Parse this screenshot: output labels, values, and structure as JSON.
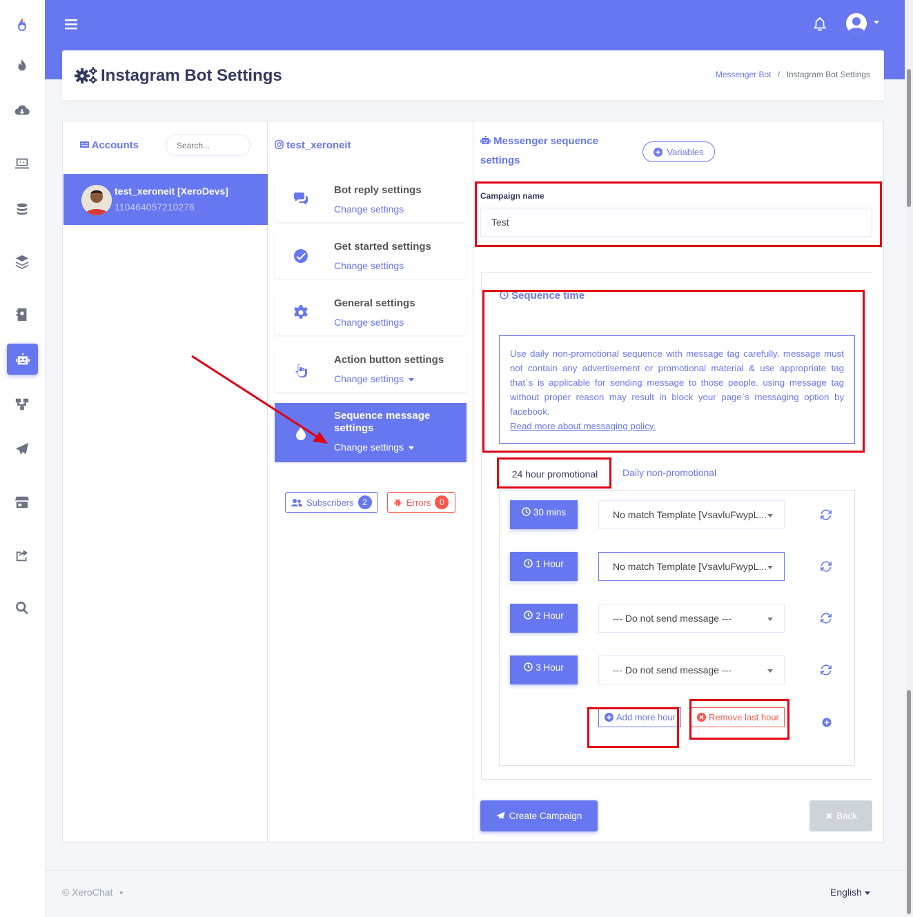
{
  "app": {
    "brand": "XeroChat",
    "accent": "#6777ef",
    "danger": "#fc544b"
  },
  "sidebar": {
    "icons": [
      "logo-icon",
      "fire-icon",
      "cloud-download-icon",
      "laptop-code-icon",
      "coins-icon",
      "layers-icon",
      "contact-book-icon",
      "robot-icon",
      "sitemap-icon",
      "paper-plane-icon",
      "store-icon",
      "share-icon",
      "search-icon"
    ]
  },
  "header": {
    "title": "Instagram Bot Settings",
    "breadcrumb": {
      "parent": "Messenger Bot",
      "separator": "/",
      "current": "Instagram Bot Settings"
    }
  },
  "accounts": {
    "title": "Accounts",
    "search_placeholder": "Search...",
    "items": [
      {
        "name": "test_xeroneit [XeroDevs]",
        "id": "110464057210276"
      }
    ]
  },
  "settings_column": {
    "title": "test_xeroneit",
    "items": [
      {
        "name": "Bot reply settings",
        "link": "Change settings",
        "icon": "comments-icon"
      },
      {
        "name": "Get started settings",
        "link": "Change settings",
        "icon": "check-circle-icon"
      },
      {
        "name": "General settings",
        "link": "Change settings",
        "icon": "gear-icon"
      },
      {
        "name": "Action button settings",
        "link": "Change settings",
        "icon": "hand-pointer-icon"
      },
      {
        "name": "Sequence message settings",
        "link": "Change settings",
        "icon": "tint-icon"
      }
    ],
    "subscribers": {
      "label": "Subscribers",
      "count": "2"
    },
    "errors": {
      "label": "Errors",
      "count": "0"
    }
  },
  "sequence": {
    "title": "Messenger sequence settings",
    "variables_label": "Variables",
    "campaign_label": "Campaign name",
    "campaign_value": "Test",
    "time_title": "Sequence time",
    "info_text": "Use daily non-promotional sequence with message tag carefully. message must not contain any advertisement or promotional material & use appropriate tag that`s is applicable for sending message to those people. using message tag without proper reason may result in block your page`s messaging option by facebook.",
    "info_link": "Read more about messaging policy.",
    "tabs": [
      "24 hour promotional",
      "Daily non-promotional"
    ],
    "rows": [
      {
        "time": "30 mins",
        "template": "No match Template [VsavluFwypL..."
      },
      {
        "time": "1 Hour",
        "template": "No match Template [VsavluFwypL..."
      },
      {
        "time": "2 Hour",
        "template": "--- Do not send message ---"
      },
      {
        "time": "3 Hour",
        "template": "--- Do not send message ---"
      }
    ],
    "add_label": "Add more hour",
    "remove_label": "Remove last hour",
    "create_label": "Create Campaign",
    "back_label": "Back"
  },
  "footer": {
    "copyright": "© XeroChat",
    "dot": "•",
    "language": "English"
  }
}
